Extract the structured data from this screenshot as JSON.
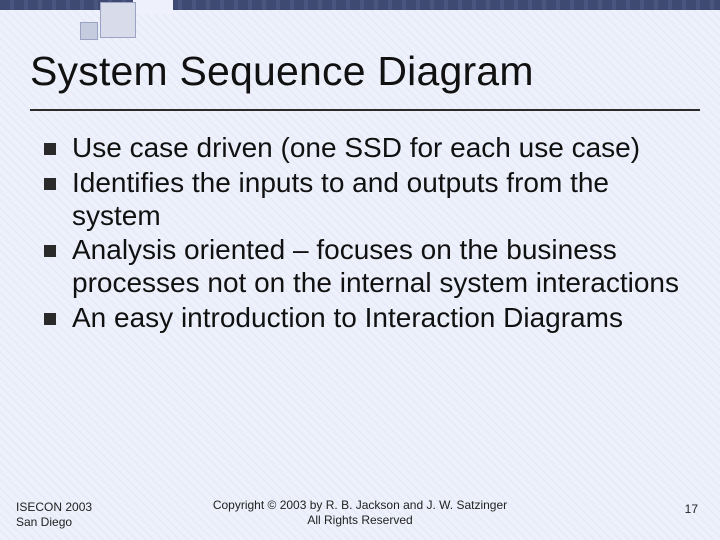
{
  "slide": {
    "title": "System Sequence Diagram",
    "bullets": [
      "Use case driven (one SSD for each use case)",
      "Identifies the inputs to and outputs from the system",
      "Analysis oriented – focuses on the business processes not on the internal system interactions",
      "An easy introduction to Interaction Diagrams"
    ]
  },
  "footer": {
    "left_line1": "ISECON 2003",
    "left_line2": "San Diego",
    "center_line1": "Copyright © 2003 by R. B. Jackson  and J. W. Satzinger",
    "center_line2": "All Rights Reserved",
    "page_number": "17"
  }
}
